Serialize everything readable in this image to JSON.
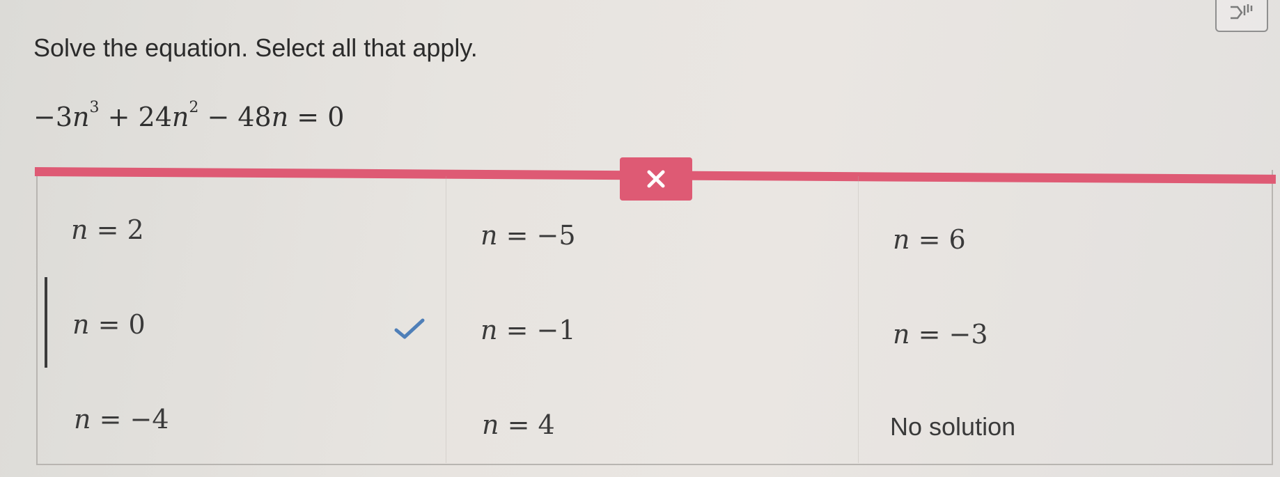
{
  "question": {
    "prompt": "Solve the equation. Select all that apply.",
    "equation_parts": [
      "−3",
      "n",
      "3",
      " + 24",
      "n",
      "2",
      " − 48",
      "n",
      " = 0"
    ]
  },
  "toolbar": {
    "tts_icon": "speaker-icon",
    "close_icon": "close-icon",
    "bar_color": "#de5a74"
  },
  "options": [
    {
      "var": "n",
      "rel": " = ",
      "value": "2"
    },
    {
      "var": "n",
      "rel": " = ",
      "value": "−5"
    },
    {
      "var": "n",
      "rel": " = ",
      "value": "6"
    },
    {
      "var": "n",
      "rel": " = ",
      "value": "0"
    },
    {
      "var": "n",
      "rel": " = ",
      "value": "−1"
    },
    {
      "var": "n",
      "rel": " = ",
      "value": "−3"
    },
    {
      "var": "n",
      "rel": " = ",
      "value": "−4"
    },
    {
      "var": "n",
      "rel": " = ",
      "value": "4"
    },
    {
      "label": "No solution"
    }
  ],
  "selection": {
    "checked_option_value": "−1",
    "check_color": "#4f7fb8"
  }
}
